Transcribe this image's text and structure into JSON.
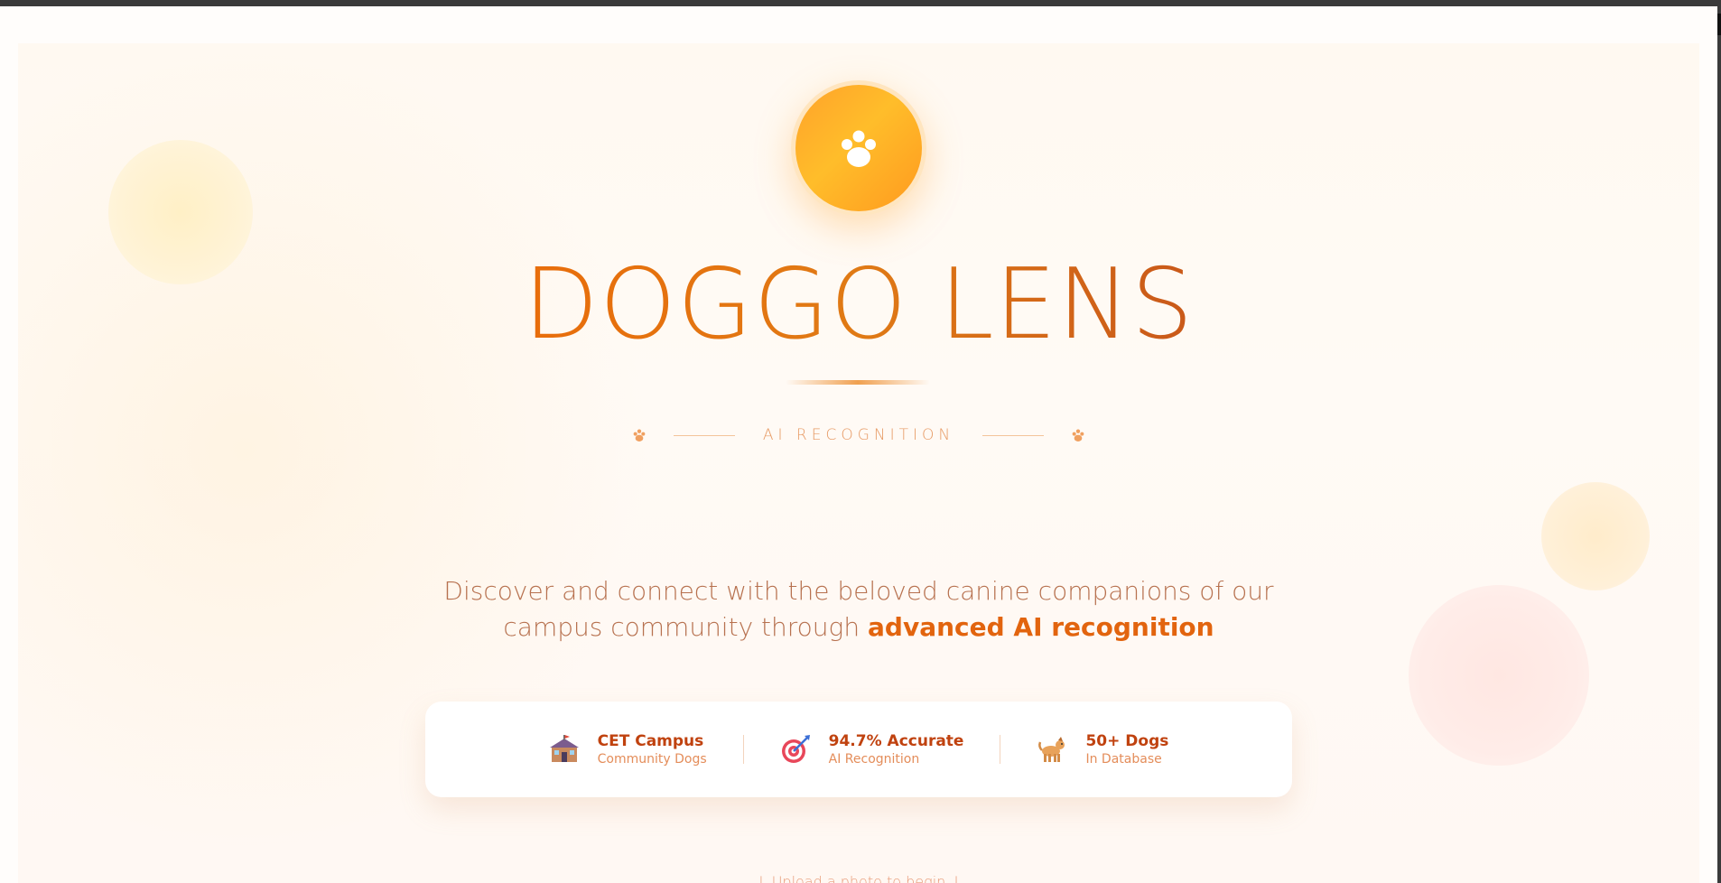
{
  "brand": {
    "title": "DOGGO LENS",
    "subtitle": "AI RECOGNITION",
    "logo_icon": "paw-icon"
  },
  "hero": {
    "description_plain": "Discover and connect with the beloved canine companions of our campus community through ",
    "description_highlight": "advanced AI recognition"
  },
  "stats": [
    {
      "icon": "school-icon",
      "title": "CET Campus",
      "subtitle": "Community Dogs"
    },
    {
      "icon": "target-icon",
      "title": "94.7% Accurate",
      "subtitle": "AI Recognition"
    },
    {
      "icon": "dog-icon",
      "title": "50+ Dogs",
      "subtitle": "In Database"
    }
  ],
  "hint": "↓ Upload a photo to begin ↓",
  "colors": {
    "accent": "#e2640e",
    "logo_gradient_start": "#ffa22a",
    "logo_gradient_end": "#ffbd2a"
  }
}
